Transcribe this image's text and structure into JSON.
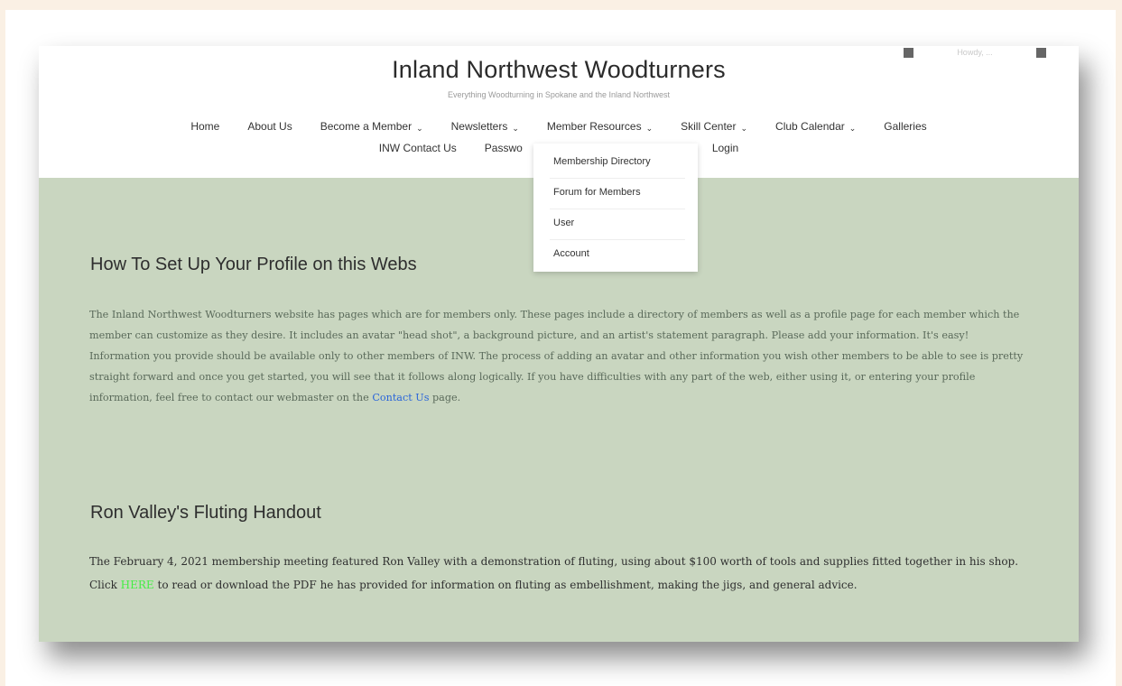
{
  "header": {
    "title": "Inland Northwest Woodturners",
    "tagline": "Everything Woodturning in Spokane and the Inland Northwest",
    "util_text": "Howdy, ..."
  },
  "nav": {
    "row1": [
      "Home",
      "About Us",
      "Become a Member",
      "Newsletters",
      "Member Resources",
      "Skill Center",
      "Club Calendar",
      "Galleries"
    ],
    "row2": [
      "INW Contact Us",
      "Passwo",
      "Login"
    ],
    "dropdown_icon": "chevron-down-icon"
  },
  "dropdown": {
    "items": [
      "Membership Directory",
      "Forum for Members",
      "User",
      "Account"
    ]
  },
  "section1": {
    "heading": "How To Set Up Your Profile on this Webs",
    "p1": "The Inland Northwest Woodturners website has pages which are for members only.  These pages include a directory of members as well as a profile page for each member which the member can customize as they desire. It includes an avatar \"head shot\", a background picture, and an artist's statement paragraph. Please add your information.  It's easy!",
    "p2_before": "Information you provide should be available only to other members of INW.  The process of adding an avatar and other information you wish other members to be able to see is pretty straight forward and once you get started, you will see that it follows along logically.  If you have difficulties with any part of the web, either using it, or entering your profile information, feel free to contact our webmaster on the ",
    "p2_link": "Contact Us",
    "p2_after": " page."
  },
  "section2": {
    "heading": "Ron Valley's Fluting Handout",
    "p_before": "The February 4, 2021 membership meeting featured Ron Valley with a demonstration of fluting, using about $100 worth of tools and supplies fitted together in his shop. Click ",
    "p_link": "HERE",
    "p_after": " to read or download the PDF he has provided for information on fluting as embellishment, making the jigs, and general advice."
  },
  "colors": {
    "content_bg": "#c9d6c0",
    "link_blue": "#2b66d9",
    "link_green": "#44ee44",
    "outer_bg": "#faf0e4"
  }
}
